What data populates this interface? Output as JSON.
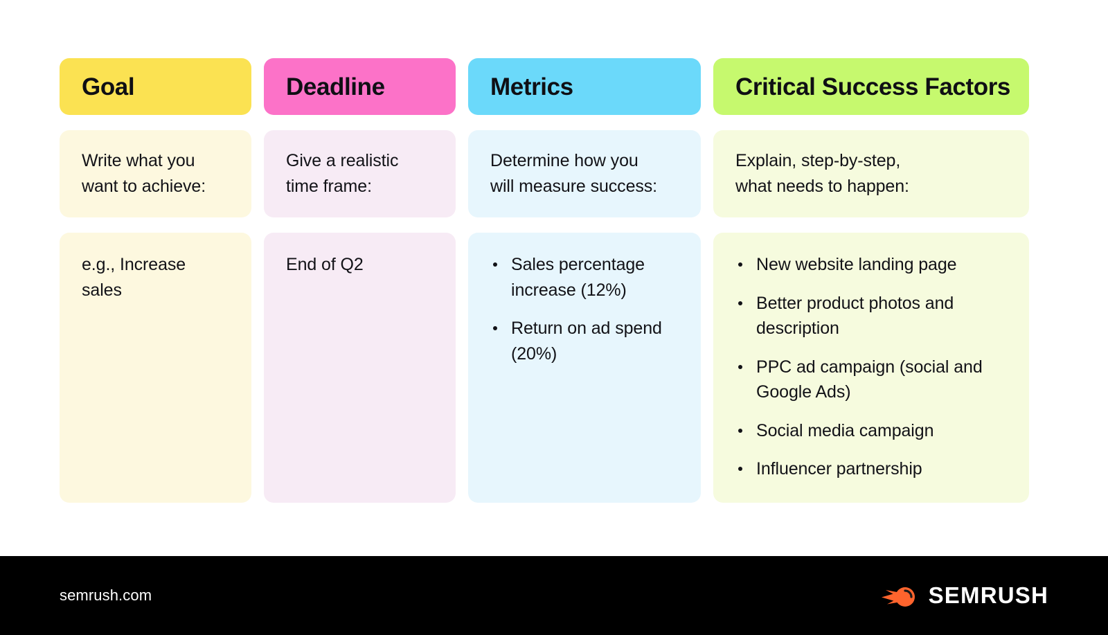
{
  "colors": {
    "goal_header": "#FBE252",
    "goal_body": "#FDF8DF",
    "deadline_header": "#FC72C8",
    "deadline_body": "#F7EBF5",
    "metrics_header": "#6BD9FA",
    "metrics_body": "#E7F6FD",
    "csf_header": "#C6F96E",
    "csf_body": "#F6FBDE",
    "footer_bg": "#000000",
    "brand_orange": "#FF642D",
    "text": "#121217"
  },
  "columns": [
    {
      "header": "Goal",
      "instruction": "Write what you\nwant to achieve:",
      "content_text": "e.g., Increase\nsales",
      "bullets": []
    },
    {
      "header": "Deadline",
      "instruction": "Give a realistic\ntime frame:",
      "content_text": "End of Q2",
      "bullets": []
    },
    {
      "header": "Metrics",
      "instruction": "Determine how you\nwill measure success:",
      "content_text": "",
      "bullets": [
        "Sales percentage increase (12%)",
        "Return on ad spend (20%)"
      ]
    },
    {
      "header": "Critical Success Factors",
      "instruction": "Explain, step-by-step,\nwhat needs to happen:",
      "content_text": "",
      "bullets": [
        "New website landing page",
        "Better product photos and description",
        "PPC ad campaign (social and Google Ads)",
        "Social media campaign",
        "Influencer partnership"
      ]
    }
  ],
  "footer": {
    "url": "semrush.com",
    "brand_name": "SEMRUSH",
    "logo_icon": "semrush-comet-icon"
  }
}
